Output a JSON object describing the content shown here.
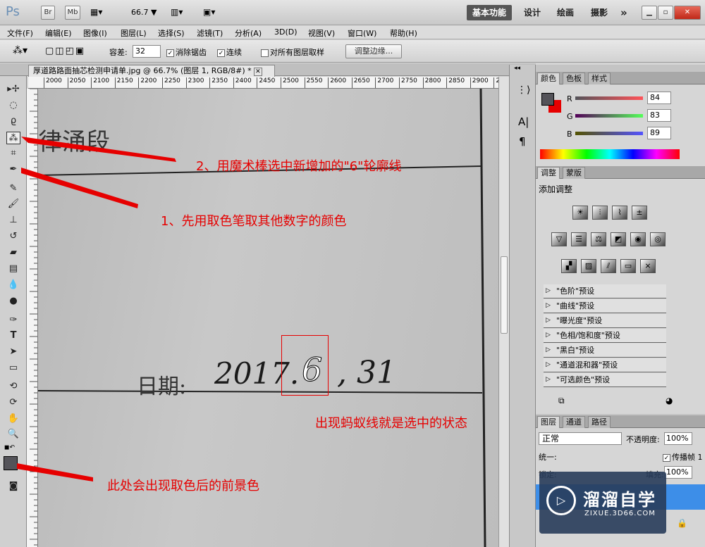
{
  "app": {
    "logo": "Ps",
    "br": "Br",
    "mb": "Mb",
    "zoom": "66.7 ▼",
    "workspaces": [
      "基本功能",
      "设计",
      "绘画",
      "摄影"
    ],
    "more": "»"
  },
  "menu": [
    "文件(F)",
    "编辑(E)",
    "图像(I)",
    "图层(L)",
    "选择(S)",
    "滤镜(T)",
    "分析(A)",
    "3D(D)",
    "视图(V)",
    "窗口(W)",
    "帮助(H)"
  ],
  "options": {
    "tolerance_label": "容差:",
    "tolerance_value": "32",
    "antialias": "消除锯齿",
    "contiguous": "连续",
    "sample_all": "对所有图层取样",
    "refine_edge": "调整边缘..."
  },
  "document": {
    "tab_title": "厚道路路面抽芯检测申请单.jpg @ 66.7% (图层 1, RGB/8#) *"
  },
  "ruler_ticks": [
    "2000",
    "2050",
    "2100",
    "2150",
    "2200",
    "2250",
    "2300",
    "2350",
    "2400",
    "2450",
    "2500",
    "2550",
    "2600",
    "2650",
    "2700",
    "2750",
    "2800",
    "2850",
    "2900",
    "295("
  ],
  "canvas": {
    "top_text": "律涌段",
    "date_label": "日期:",
    "handwriting_left": "2017.",
    "handwriting_digit": "6",
    "handwriting_right": ", 31"
  },
  "annotations": {
    "step2": "2、用魔术棒选中新增加的\"6\"轮廓线",
    "step1": "1、先用取色笔取其他数字的颜色",
    "marching": "出现蚂蚁线就是选中的状态",
    "foreground": "此处会出现取色后的前景色"
  },
  "color_panel": {
    "tabs": [
      "颜色",
      "色板",
      "样式"
    ],
    "channels": [
      {
        "label": "R",
        "value": "84"
      },
      {
        "label": "G",
        "value": "83"
      },
      {
        "label": "B",
        "value": "89"
      }
    ]
  },
  "adjust_panel": {
    "tabs": [
      "调整",
      "蒙版"
    ],
    "title": "添加调整",
    "presets": [
      "\"色阶\"预设",
      "\"曲线\"预设",
      "\"曝光度\"预设",
      "\"色相/饱和度\"预设",
      "\"黑白\"预设",
      "\"通道混和器\"预设",
      "\"可选颜色\"预设"
    ]
  },
  "layers_panel": {
    "tabs": [
      "图层",
      "通道",
      "路径"
    ],
    "blend_mode": "正常",
    "opacity_label": "不透明度:",
    "opacity_value": "100%",
    "unify_label": "统一:",
    "propagate": "传播帧 1",
    "lock_label": "锁定:",
    "fill_label": "填充:",
    "fill_value": "100%"
  },
  "watermark": {
    "name": "溜溜自学",
    "url": "ZIXUE.3D66.COM"
  },
  "colors": {
    "annotation": "#e60000",
    "foreground": "#545359",
    "background": "#e60000"
  }
}
